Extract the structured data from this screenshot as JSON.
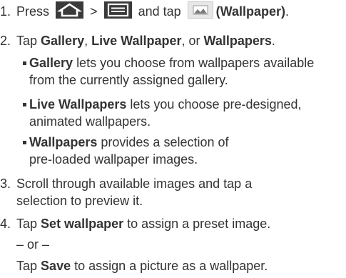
{
  "steps": [
    {
      "num": "1.",
      "text_before": "Press",
      "sep1": ">",
      "text_mid": "and tap",
      "bold_text": "(Wallpaper)",
      "end": ".",
      "icons": [
        "home-icon",
        "menu-icon",
        "wallpaper-icon"
      ]
    },
    {
      "num": "2.",
      "prefix": "Tap",
      "gallery": "Gallery",
      "comma1": ",",
      "live": "Live Wallpaper",
      "or_text": ", or",
      "wallpapers": "Wallpapers",
      "end": "."
    },
    {
      "num": "3.",
      "line1": "Scroll through available images and tap a",
      "line2": "selection to preview it."
    },
    {
      "num": "4.",
      "prefix": "Tap",
      "bold_text": "Set wallpaper",
      "suffix": "to assign a preset image."
    }
  ],
  "bullets": [
    {
      "bold_text": "Gallery",
      "line1_rest": "lets you choose from wallpapers available",
      "line2": "from the currently assigned gallery."
    },
    {
      "bold_text": "Live Wallpapers",
      "line1_rest": "lets you choose pre-designed,",
      "line2": "animated wallpapers."
    },
    {
      "bold_text": "Wallpapers",
      "line1_rest": "provides a selection of",
      "line2": "pre-loaded wallpaper images."
    }
  ],
  "or_line": "– or –",
  "final": {
    "prefix": "Tap",
    "bold_text": "Save",
    "suffix": "to assign a picture as a wallpaper."
  }
}
